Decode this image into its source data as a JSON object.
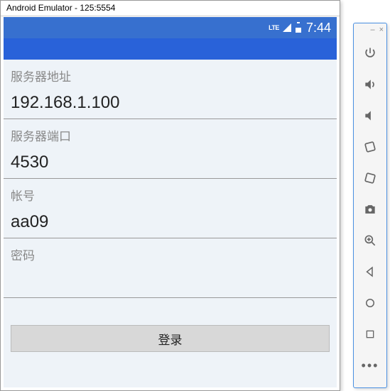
{
  "window": {
    "title": "Android Emulator - 125:5554"
  },
  "status": {
    "lte": "LTE",
    "clock": "7:44"
  },
  "form": {
    "server_addr_label": "服务器地址",
    "server_addr_value": "192.168.1.100",
    "server_port_label": "服务器端口",
    "server_port_value": "4530",
    "account_label": "帐号",
    "account_value": "aa09",
    "password_label": "密码",
    "password_value": "",
    "login_label": "登录"
  },
  "toolbar": {
    "minimize": "–",
    "close": "×",
    "more": "•••"
  }
}
